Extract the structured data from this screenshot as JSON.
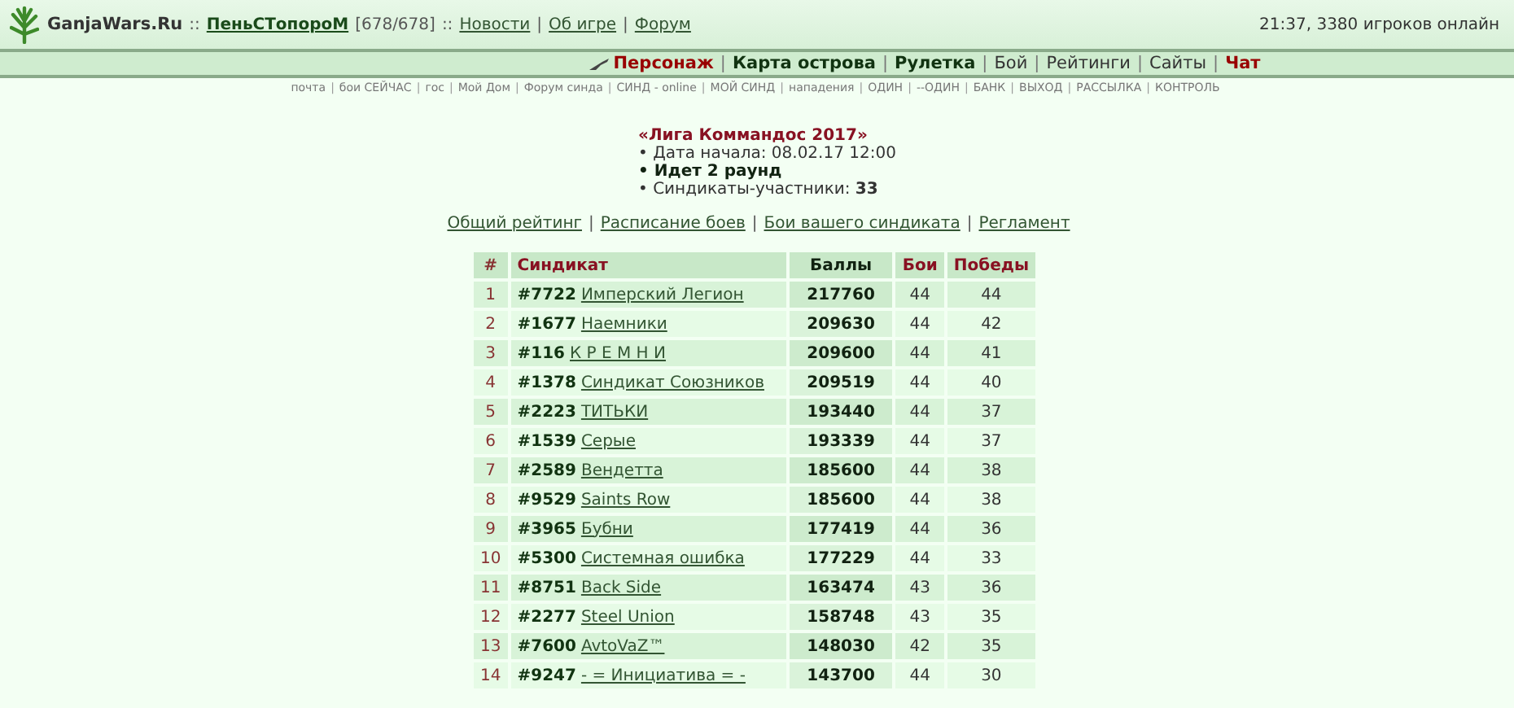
{
  "header": {
    "site": "GanjaWars.Ru",
    "sep": "::",
    "user": "ПеньСТопороМ",
    "hp": "[678/678]",
    "links": [
      "Новости",
      "Об игре",
      "Форум"
    ],
    "status": "21:37, 3380 игроков онлайн"
  },
  "separator": "|",
  "nav": [
    {
      "label": "Персонаж",
      "kind": "red"
    },
    {
      "label": "Карта острова",
      "kind": "bold"
    },
    {
      "label": "Рулетка",
      "kind": "bold"
    },
    {
      "label": "Бой",
      "kind": "plain"
    },
    {
      "label": "Рейтинги",
      "kind": "plain"
    },
    {
      "label": "Сайты",
      "kind": "plain"
    },
    {
      "label": "Чат",
      "kind": "red"
    }
  ],
  "subnav": [
    "почта",
    "бои СЕЙЧАС",
    "гос",
    "Мой Дом",
    "Форум синда",
    "СИНД - online",
    "МОЙ СИНД",
    "нападения",
    "ОДИН",
    "--ОДИН",
    "БАНК",
    "ВЫХОД",
    "РАССЫЛКА",
    "КОНТРОЛЬ"
  ],
  "league": {
    "title": "«Лига Коммандос 2017»",
    "bullet": "•",
    "start": "Дата начала: 08.02.17 12:00",
    "round": "Идет 2 раунд",
    "members_label": "Синдикаты-участники:",
    "members": "33"
  },
  "links": [
    "Общий рейтинг",
    "Расписание боев",
    "Бои вашего синдиката",
    "Регламент"
  ],
  "table": {
    "columns": [
      "#",
      "Синдикат",
      "Баллы",
      "Бои",
      "Победы"
    ],
    "rows": [
      {
        "n": "1",
        "id": "#7722",
        "name": "Имперский Легион",
        "points": "217760",
        "fights": "44",
        "wins": "44"
      },
      {
        "n": "2",
        "id": "#1677",
        "name": "Наемники",
        "points": "209630",
        "fights": "44",
        "wins": "42"
      },
      {
        "n": "3",
        "id": "#116",
        "name": "К Р Е М Н И",
        "points": "209600",
        "fights": "44",
        "wins": "41"
      },
      {
        "n": "4",
        "id": "#1378",
        "name": "Синдикат Союзников",
        "points": "209519",
        "fights": "44",
        "wins": "40"
      },
      {
        "n": "5",
        "id": "#2223",
        "name": "ТИТЬКИ",
        "points": "193440",
        "fights": "44",
        "wins": "37"
      },
      {
        "n": "6",
        "id": "#1539",
        "name": "Серые",
        "points": "193339",
        "fights": "44",
        "wins": "37"
      },
      {
        "n": "7",
        "id": "#2589",
        "name": "Вендетта",
        "points": "185600",
        "fights": "44",
        "wins": "38"
      },
      {
        "n": "8",
        "id": "#9529",
        "name": "Saints Row",
        "points": "185600",
        "fights": "44",
        "wins": "38"
      },
      {
        "n": "9",
        "id": "#3965",
        "name": "Бубни",
        "points": "177419",
        "fights": "44",
        "wins": "36"
      },
      {
        "n": "10",
        "id": "#5300",
        "name": "Системная ошибка",
        "points": "177229",
        "fights": "44",
        "wins": "33"
      },
      {
        "n": "11",
        "id": "#8751",
        "name": "Back Side",
        "points": "163474",
        "fights": "43",
        "wins": "36"
      },
      {
        "n": "12",
        "id": "#2277",
        "name": "Steel Union",
        "points": "158748",
        "fights": "43",
        "wins": "35"
      },
      {
        "n": "13",
        "id": "#7600",
        "name": "AvtoVaZ™",
        "points": "148030",
        "fights": "42",
        "wins": "35"
      },
      {
        "n": "14",
        "id": "#9247",
        "name": "- = Инициатива = -",
        "points": "143700",
        "fights": "44",
        "wins": "30"
      }
    ]
  }
}
